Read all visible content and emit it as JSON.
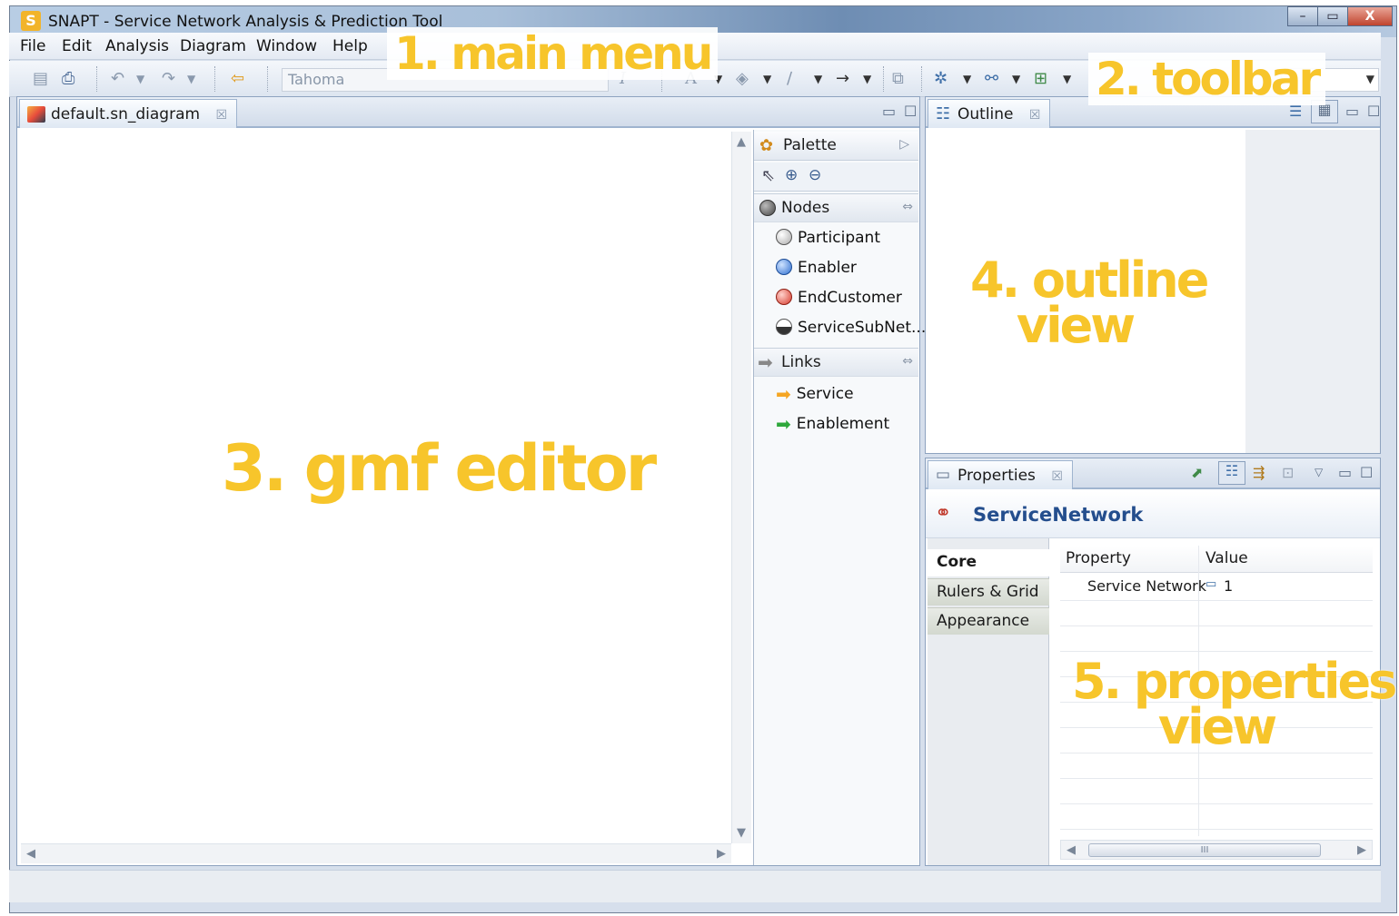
{
  "window": {
    "title": "SNAPT - Service Network Analysis & Prediction Tool",
    "app_icon_letter": "S",
    "controls": {
      "minimize": "–",
      "maximize": "▭",
      "close": "X"
    }
  },
  "menu": {
    "items": [
      "File",
      "Edit",
      "Analysis",
      "Diagram",
      "Window",
      "Help"
    ]
  },
  "toolbar": {
    "font_name": "Tahoma"
  },
  "editor": {
    "tab_label": "default.sn_diagram",
    "tab_close": "☒"
  },
  "palette": {
    "title": "Palette",
    "drawers": [
      {
        "label": "Nodes",
        "entries": [
          "Participant",
          "Enabler",
          "EndCustomer",
          "ServiceSubNet..."
        ]
      },
      {
        "label": "Links",
        "entries": [
          "Service",
          "Enablement"
        ]
      }
    ]
  },
  "outline": {
    "tab_label": "Outline",
    "tab_close": "☒"
  },
  "properties": {
    "tab_label": "Properties",
    "tab_close": "☒",
    "title": "ServiceNetwork",
    "tabs": [
      "Core",
      "Rulers & Grid",
      "Appearance"
    ],
    "columns": [
      "Property",
      "Value"
    ],
    "rows": [
      {
        "property": "Service Network",
        "value": "1"
      }
    ],
    "scroll_thumb_label": "III"
  },
  "annotations": {
    "main_menu": "1. main menu",
    "toolbar": "2. toolbar",
    "gmf_editor": "3. gmf editor",
    "outline_line1": "4. outline",
    "outline_line2": "view",
    "properties_line1": "5. properties",
    "properties_line2": "view"
  },
  "colors": {
    "annotation": "#f7c52b",
    "properties_title": "#244e8d",
    "enabler_icon": "#2f6fd0",
    "endcustomer_icon": "#d63a2c",
    "service_link": "#f5a623",
    "enablement_link": "#2ea83b"
  }
}
